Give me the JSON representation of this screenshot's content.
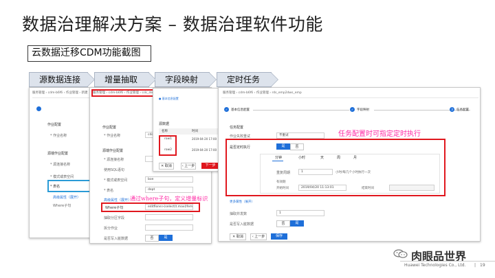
{
  "slide": {
    "title": "数据治理解决方案 – 数据治理软件功能",
    "subtitle": "云数据迁移CDM功能截图",
    "steps": [
      "源数据连接",
      "增量抽取",
      "字段映射",
      "定时任务"
    ]
  },
  "shot1": {
    "crumb": "服务管理 › cdm-b6f6 › 作业管理 › 新建",
    "sections": [
      "作业配置",
      "源端作业配置"
    ],
    "fields": [
      "* 作业名称",
      "* 源连接名称",
      "* 模式或表空间",
      "* 表名",
      "Where子句"
    ],
    "link": "高级属性（展开）"
  },
  "shot2": {
    "crumb": "服务管理 › cdm-b6f6 › 作业管理 › cdc_dept",
    "sections": [
      "作业配置",
      "源端作业配置"
    ],
    "job_name_label": "* 作业名称",
    "job_name_value": "cdc_dept",
    "fields": [
      "* 源连接名称",
      "使用SQL语句",
      "* 模式或表空间",
      "* 表名",
      "高级属性（展开）"
    ],
    "schema_value": "boe",
    "table_value": "dept",
    "where_label": "Where子句",
    "where_value": "editflone>(select(t.max(lfeme)",
    "extra_fields": [
      "抽取分区字段",
      "拆分作业",
      "是否写入脏数据"
    ],
    "toggle_no": "否",
    "toggle_yes": "是",
    "annotation": "通过where子句，定义增量标识"
  },
  "shot3": {
    "step_text": "● 基本信息配置",
    "source_label": "源数据",
    "col_name": "名称",
    "col_time": "时间",
    "rows": [
      {
        "name": "row1",
        "time": "2019-04-20 17:00"
      },
      {
        "name": "row2",
        "time": "2019-04-20 17:00"
      }
    ],
    "cancel": "✕ 取消",
    "prev": "‹ 上一步",
    "next": "下一步"
  },
  "shot4": {
    "crumb": "服务管理 › cdm-b6f6 › 作业管理 › rds_emp2dws_emp",
    "step1": "基本信息配置",
    "step2": "字段映射",
    "step3": "任务配置",
    "section": "任务配置",
    "retry_label": "作业失败重试",
    "retry_value": "不重试",
    "schedule_label": "是否定时执行",
    "sched_yes": "是",
    "sched_no": "否",
    "tabs": [
      "分钟",
      "小时",
      "天",
      "周",
      "月"
    ],
    "repeat_label": "重复周期",
    "repeat_value": "1",
    "repeat_hint": "小时/每几个小时执行一次",
    "valid_label": "有效期",
    "start_label": "开始时间",
    "start_value": "2019/04/20 11:13:01",
    "end_label": "结束时间",
    "more_link": "更多属性（展开）",
    "concurrency_label": "抽取并发数",
    "concurrency_value": "1",
    "dirty_label": "是否写入脏数据",
    "dirty_no": "否",
    "dirty_yes": "是",
    "cancel": "✕ 取消",
    "prev": "‹ 上一步",
    "save": "保存",
    "annotation": "任务配置时可指定定时执行"
  },
  "footer": {
    "brand": "肉眼品世界",
    "company": "Huawei Technologies Co., Ltd.",
    "page": "19"
  },
  "colors": {
    "red_box": "#e0161d",
    "annotation": "#ff2aa5",
    "accent_blue": "#1e6fd9"
  }
}
